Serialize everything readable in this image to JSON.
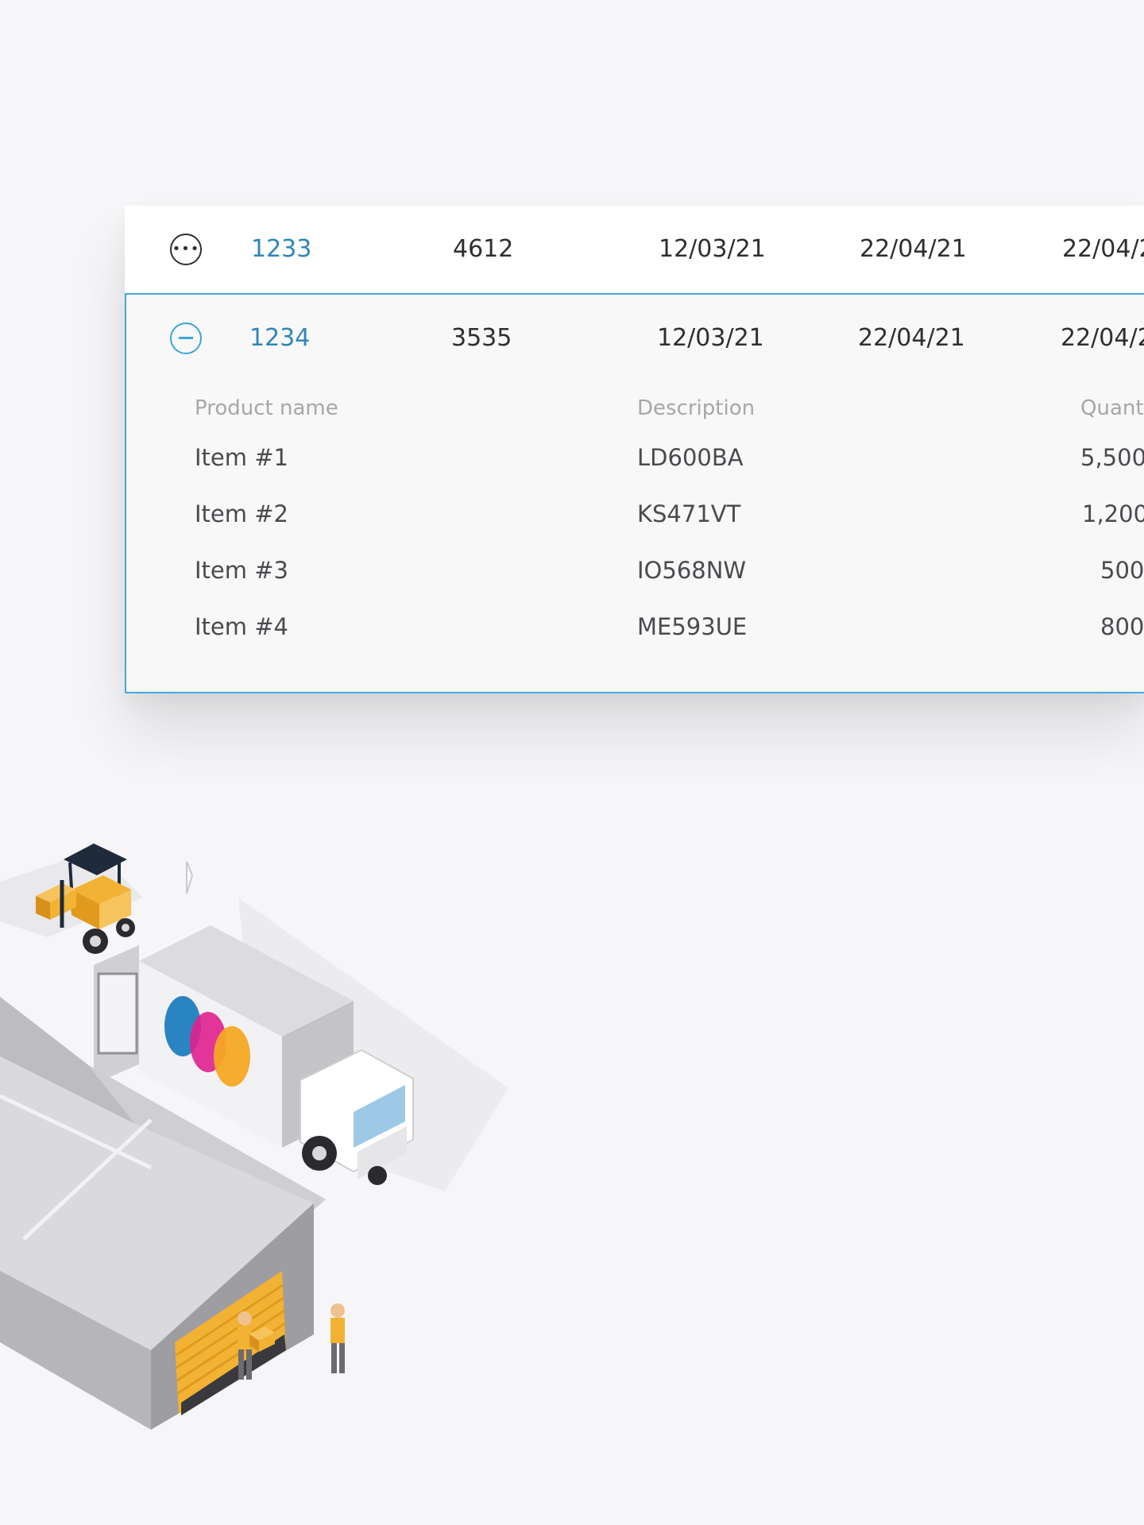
{
  "orders": [
    {
      "id": "1233",
      "ref": "4612",
      "date1": "12/03/21",
      "date2": "22/04/21",
      "date3": "22/04/2",
      "action_icon": "more-options-icon",
      "expanded": false
    },
    {
      "id": "1234",
      "ref": "3535",
      "date1": "12/03/21",
      "date2": "22/04/21",
      "date3": "22/04/2",
      "action_icon": "collapse-minus-icon",
      "expanded": true
    }
  ],
  "details": {
    "headers": {
      "product": "Product name",
      "description": "Description",
      "quantity": "Quant"
    },
    "rows": [
      {
        "product": "Item #1",
        "description": "LD600BA",
        "quantity": "5,500."
      },
      {
        "product": "Item #2",
        "description": "KS471VT",
        "quantity": "1,200."
      },
      {
        "product": "Item #3",
        "description": "IO568NW",
        "quantity": "500."
      },
      {
        "product": "Item #4",
        "description": "ME593UE",
        "quantity": "800."
      }
    ]
  },
  "colors": {
    "accent": "#3aa6d8",
    "link": "#2f86b8",
    "text": "#2f2f33",
    "muted": "#a7a7ab",
    "background": "#f6f6f8"
  },
  "illustration": {
    "icon": "warehouse-logistics-illustration"
  }
}
